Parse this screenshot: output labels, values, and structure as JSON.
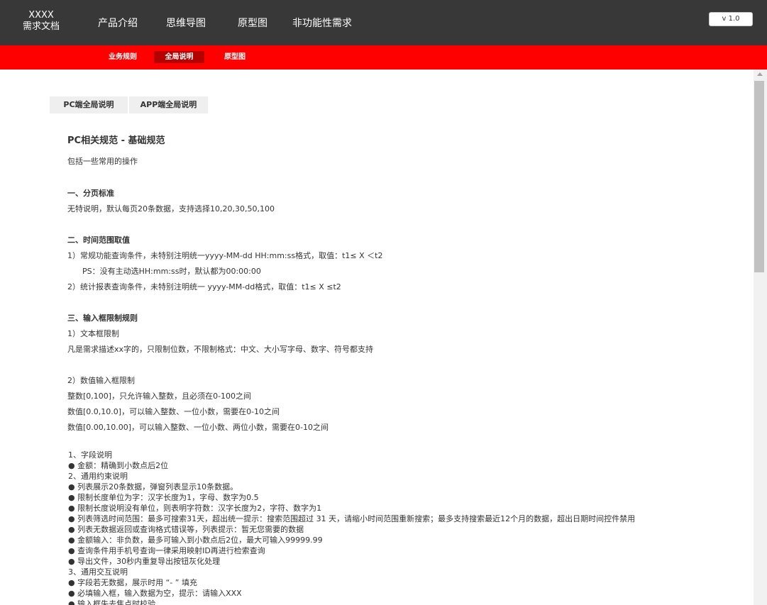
{
  "header": {
    "brand_line1": "XXXX",
    "brand_line2": "需求文档",
    "nav": [
      "产品介绍",
      "思维导图",
      "原型图",
      "非功能性需求"
    ],
    "version": "v 1.0"
  },
  "subnav": {
    "items": [
      "业务规则",
      "全局说明",
      "原型图"
    ],
    "active": "全局说明"
  },
  "tabs": [
    "PC端全局说明",
    "APP端全局说明"
  ],
  "doc": {
    "title": "PC相关规范 - 基础规范",
    "intro": "包括一些常用的操作",
    "sec1_title": "一、分页标准",
    "sec1_text": "无特说明，默认每页20条数据，支持选择10,20,30,50,100",
    "sec2_title": "二、时间范围取值",
    "sec2_l1": "1）常规功能查询条件，未特别注明统一yyyy-MM-dd HH:mm:ss格式，取值：t1≤ X ＜t2",
    "sec2_l2": "PS：没有主动选HH:mm:ss时，默认都为00:00:00",
    "sec2_l3": "2）统计报表查询条件，未特别注明统一 yyyy-MM-dd格式，取值：t1≤ X ≤t2",
    "sec3_title": "三、输入框限制规则",
    "sec3_l1": "1）文本框限制",
    "sec3_l2": "凡是需求描述xx字的，只限制位数，不限制格式：中文、大小写字母、数字、符号都支持",
    "sec3_l3": "2）数值输入框限制",
    "sec3_l4": "整数[0,100]，只允许输入整数，且必须在0-100之间",
    "sec3_l5": "数值[0.0,10.0]，可以输入整数、一位小数，需要在0-10之间",
    "sec3_l6": "数值[0.00,10.00]，可以输入整数、一位小数、两位小数，需要在0-10之间",
    "list": [
      "1、字段说明",
      "● 金额：精确到小数点后2位",
      "2、通用约束说明",
      "● 列表展示20条数据，弹窗列表显示10条数据。",
      "● 限制长度单位为字：汉字长度为1，字母、数字为0.5",
      "● 限制长度说明没有单位，则表明字符数：汉字长度为2，字符、数字为1",
      "● 列表筛选时间范围：最多可搜索31天，超出统一提示：搜索范围超过 31 天，请缩小时间范围重新搜索；最多支持搜索最近12个月的数据，超出日期时间控件禁用",
      "● 列表无数据返回或查询格式错误等，列表提示：暂无您需要的数据",
      "● 金额输入：非负数，最多可输入到小数点后2位，最大可输入99999.99",
      "● 查询条件用手机号查询一律采用映射ID再进行检索查询",
      "● 导出文件，30秒内重复导出按钮灰化处理",
      "3、通用交互说明",
      "● 字段若无数据，展示时用 “- ” 填充",
      "● 必填输入框，输入数据为空，提示：请输入XXX",
      "● 输入框失去焦点时校验"
    ]
  }
}
